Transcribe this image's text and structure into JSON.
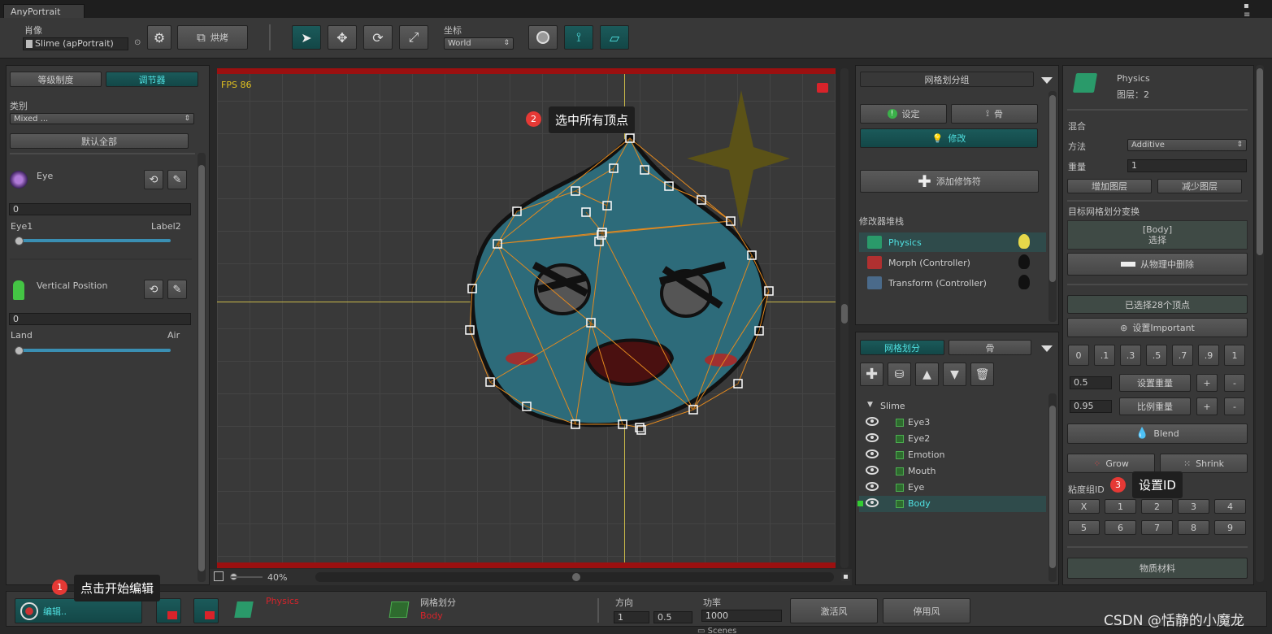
{
  "window": {
    "tab_title": "AnyPortrait"
  },
  "toolbar": {
    "portrait_label": "肖像",
    "portrait_value": "Slime (apPortrait)",
    "bake_label": "烘烤",
    "coord_label": "坐标",
    "coord_value": "World"
  },
  "left_panel": {
    "tab_hierarchy": "等级制度",
    "tab_controller": "调节器",
    "category_label": "类别",
    "category_value": "Mixed ...",
    "reset_all": "默认全部",
    "controllers": [
      {
        "name": "Eye",
        "value": "0",
        "min_label": "Eye1",
        "max_label": "Label2",
        "level": 0.0
      },
      {
        "name": "Vertical Position",
        "value": "0",
        "min_label": "Land",
        "max_label": "Air",
        "level": 0.0
      }
    ]
  },
  "viewport": {
    "fps": "FPS 86",
    "zoom": "40%"
  },
  "mesh_group_panel": {
    "title": "网格划分组",
    "settings_button": "设定",
    "bone_button": "骨",
    "modify_button": "修改",
    "add_modifier": "添加修饰符",
    "stack_label": "修改器堆栈",
    "modifiers": [
      {
        "name": "Physics",
        "active": true
      },
      {
        "name": "Morph (Controller)",
        "active": false
      },
      {
        "name": "Transform (Controller)",
        "active": false
      }
    ]
  },
  "mesh_list_panel": {
    "tab_mesh": "网格划分",
    "tab_bone": "骨",
    "root": "Slime",
    "items": [
      "Eye3",
      "Eye2",
      "Emotion",
      "Mouth",
      "Eye",
      "Body"
    ],
    "selected": "Body"
  },
  "inspector": {
    "title": "Physics",
    "layer": "图层：2",
    "blend_header": "混合",
    "method_label": "方法",
    "method_value": "Additive",
    "weight_label": "重量",
    "weight_value": "1",
    "add_layer": "增加图层",
    "remove_layer": "减少图层",
    "target_label": "目标网格划分变换",
    "target_value": "[Body]",
    "target_select": "选择",
    "remove_from_physics": "从物理中删除",
    "selected_vertices": "已选择28个顶点",
    "set_important": "设置Important",
    "weight_presets": [
      "0",
      ".1",
      ".3",
      ".5",
      ".7",
      ".9",
      "1"
    ],
    "set_weight_value": "0.5",
    "set_weight_label": "设置重量",
    "ratio_weight_value": "0.95",
    "ratio_weight_label": "比例重量",
    "plus": "+",
    "minus": "-",
    "blend_button": "Blend",
    "grow_button": "Grow",
    "shrink_button": "Shrink",
    "viscosity_label": "粘度组ID",
    "viscosity_ids": [
      "X",
      "1",
      "2",
      "3",
      "4",
      "5",
      "6",
      "7",
      "8",
      "9"
    ],
    "material_button": "物质材料"
  },
  "bottom_bar": {
    "edit_button": "编辑..",
    "modifier_name": "Physics",
    "mesh_label": "网格划分",
    "mesh_value": "Body",
    "direction_label": "方向",
    "direction_x": "1",
    "direction_y": "0.5",
    "power_label": "功率",
    "power_value": "1000",
    "wind_on": "激活风",
    "wind_off": "停用风",
    "scenes_label": "Scenes"
  },
  "tutorial": {
    "step1_num": "1",
    "step1_text": "点击开始编辑",
    "step2_num": "2",
    "step2_text": "选中所有顶点",
    "step3_num": "3",
    "step3_text": "设置ID"
  },
  "watermark": "CSDN @恬静的小魔龙",
  "colors": {
    "accent": "#4fe0e0",
    "teal_bg": "#134747",
    "viewport_bar": "#9b1010",
    "mesh_line": "#e58a1e",
    "slime": "#2d6b7a",
    "star": "#5b5217"
  }
}
